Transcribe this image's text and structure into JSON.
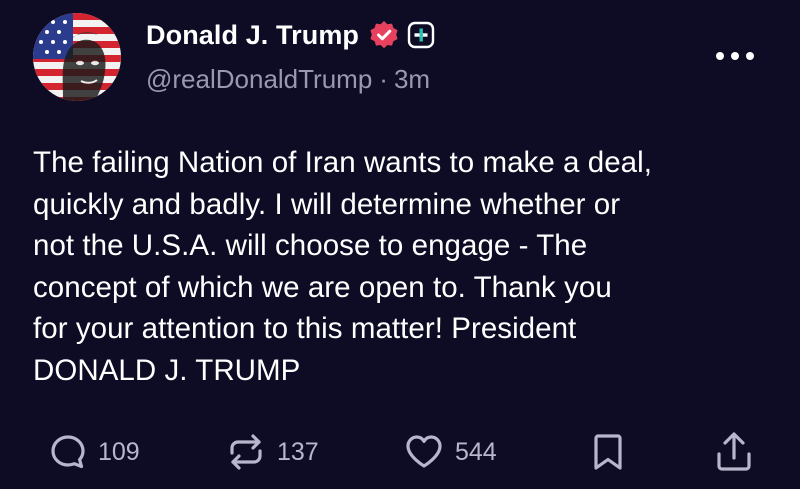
{
  "author": {
    "display_name": "Donald J. Trump",
    "handle": "@realDonaldTrump",
    "separator": "·",
    "time_ago": "3m",
    "avatar_icon": "avatar-flag-portrait",
    "verified_icon": "verified-badge-icon",
    "plus_icon": "plus-badge-icon"
  },
  "post": {
    "text": "The failing Nation of Iran wants to make a deal,\nquickly and badly. I will determine whether or\nnot the U.S.A. will choose to engage - The\nconcept of which we are open to. Thank you\nfor your attention to this matter! President\nDONALD J. TRUMP"
  },
  "actions": {
    "reply": {
      "icon": "reply-icon",
      "count": "109"
    },
    "repost": {
      "icon": "repost-icon",
      "count": "137"
    },
    "like": {
      "icon": "heart-icon",
      "count": "544"
    },
    "bookmark": {
      "icon": "bookmark-icon"
    },
    "share": {
      "icon": "share-icon"
    },
    "more": {
      "icon": "more-icon"
    }
  },
  "colors": {
    "background": "#0e0c24",
    "primary_text": "#ffffff",
    "secondary_text": "#9a98b0",
    "action_text": "#b8b6cc",
    "verified_badge": "#e8415e",
    "plus_badge_fill": "#1fc3b0"
  }
}
